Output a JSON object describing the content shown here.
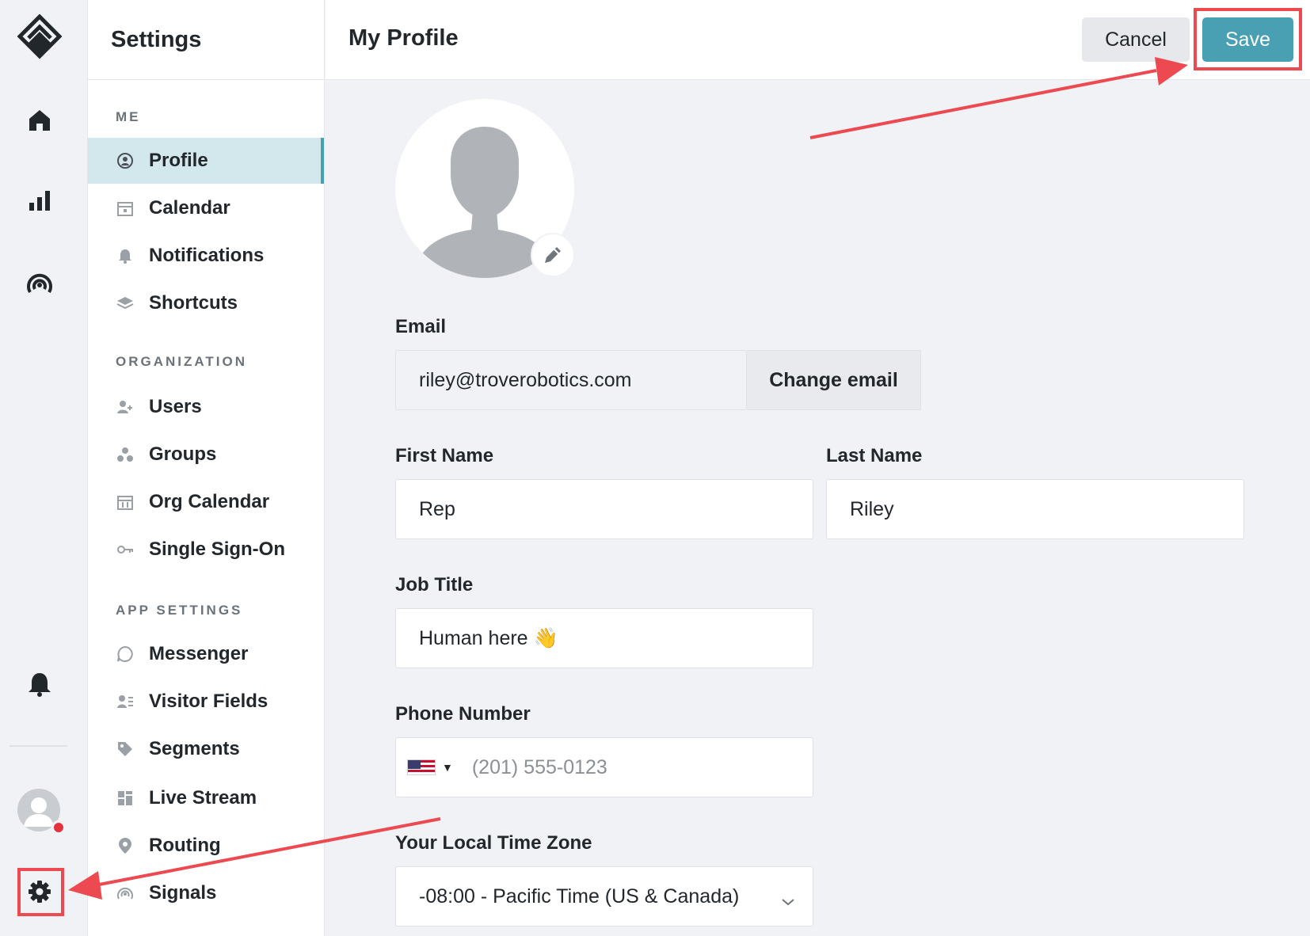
{
  "rail": {
    "icons": [
      "app-logo-icon",
      "home-icon",
      "bar-chart-icon",
      "signal-icon",
      "bell-icon",
      "avatar",
      "gear-icon"
    ]
  },
  "sidebar": {
    "title": "Settings",
    "sections": [
      {
        "label": "ME",
        "items": [
          {
            "label": "Profile",
            "icon": "user-circle-icon",
            "active": true
          },
          {
            "label": "Calendar",
            "icon": "calendar-icon"
          },
          {
            "label": "Notifications",
            "icon": "bell-icon"
          },
          {
            "label": "Shortcuts",
            "icon": "layers-icon"
          }
        ]
      },
      {
        "label": "ORGANIZATION",
        "items": [
          {
            "label": "Users",
            "icon": "user-plus-icon"
          },
          {
            "label": "Groups",
            "icon": "groups-icon"
          },
          {
            "label": "Org Calendar",
            "icon": "org-calendar-icon"
          },
          {
            "label": "Single Sign-On",
            "icon": "key-icon"
          }
        ]
      },
      {
        "label": "APP SETTINGS",
        "items": [
          {
            "label": "Messenger",
            "icon": "chat-bubble-icon"
          },
          {
            "label": "Visitor Fields",
            "icon": "visitor-fields-icon"
          },
          {
            "label": "Segments",
            "icon": "tag-icon"
          },
          {
            "label": "Live Stream",
            "icon": "live-stream-icon"
          },
          {
            "label": "Routing",
            "icon": "location-pin-icon"
          },
          {
            "label": "Signals",
            "icon": "signal-icon"
          }
        ]
      }
    ]
  },
  "header": {
    "title": "My Profile",
    "cancel_label": "Cancel",
    "save_label": "Save"
  },
  "form": {
    "email": {
      "label": "Email",
      "value": "riley@troverobotics.com",
      "action_label": "Change email"
    },
    "first_name": {
      "label": "First Name",
      "value": "Rep"
    },
    "last_name": {
      "label": "Last Name",
      "value": "Riley"
    },
    "job_title": {
      "label": "Job Title",
      "value": "Human here 👋"
    },
    "phone": {
      "label": "Phone Number",
      "placeholder": "(201) 555-0123",
      "country": "US"
    },
    "timezone": {
      "label": "Your Local Time Zone",
      "value": "-08:00 - Pacific Time (US & Canada)"
    }
  },
  "colors": {
    "accent": "#4aa0b3",
    "active_nav_bg": "#d3e8ec",
    "annotation_red": "#ec4a50",
    "notification_dot": "#e5323f"
  }
}
